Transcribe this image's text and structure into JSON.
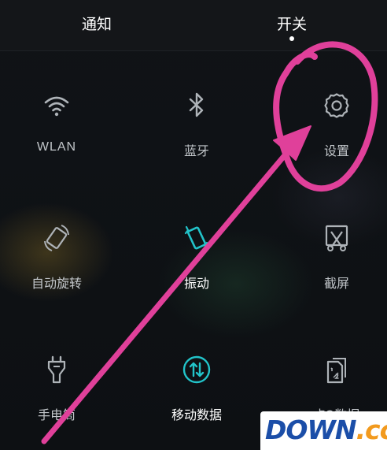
{
  "tabs": {
    "notify": "通知",
    "switch": "开关"
  },
  "tiles": [
    {
      "label": "WLAN",
      "icon": "wifi-icon"
    },
    {
      "label": "蓝牙",
      "icon": "bluetooth-icon"
    },
    {
      "label": "设置",
      "icon": "gear-icon"
    },
    {
      "label": "自动旋转",
      "icon": "auto-rotate-icon"
    },
    {
      "label": "振动",
      "icon": "vibrate-icon"
    },
    {
      "label": "截屏",
      "icon": "screenshot-icon"
    },
    {
      "label": "手电筒",
      "icon": "flashlight-icon"
    },
    {
      "label": "移动数据",
      "icon": "mobile-data-icon"
    },
    {
      "label": "卡2数据",
      "icon": "sim2-data-icon"
    }
  ],
  "watermark": {
    "main": "DOWN",
    "tld": ".cc"
  },
  "colors": {
    "background": "#0f1215",
    "icon_inactive": "#aeb3b8",
    "icon_active": "#22c3c9",
    "annotation": "#e0409a",
    "watermark_blue": "#1b4ea8",
    "watermark_orange": "#f29a1e"
  }
}
